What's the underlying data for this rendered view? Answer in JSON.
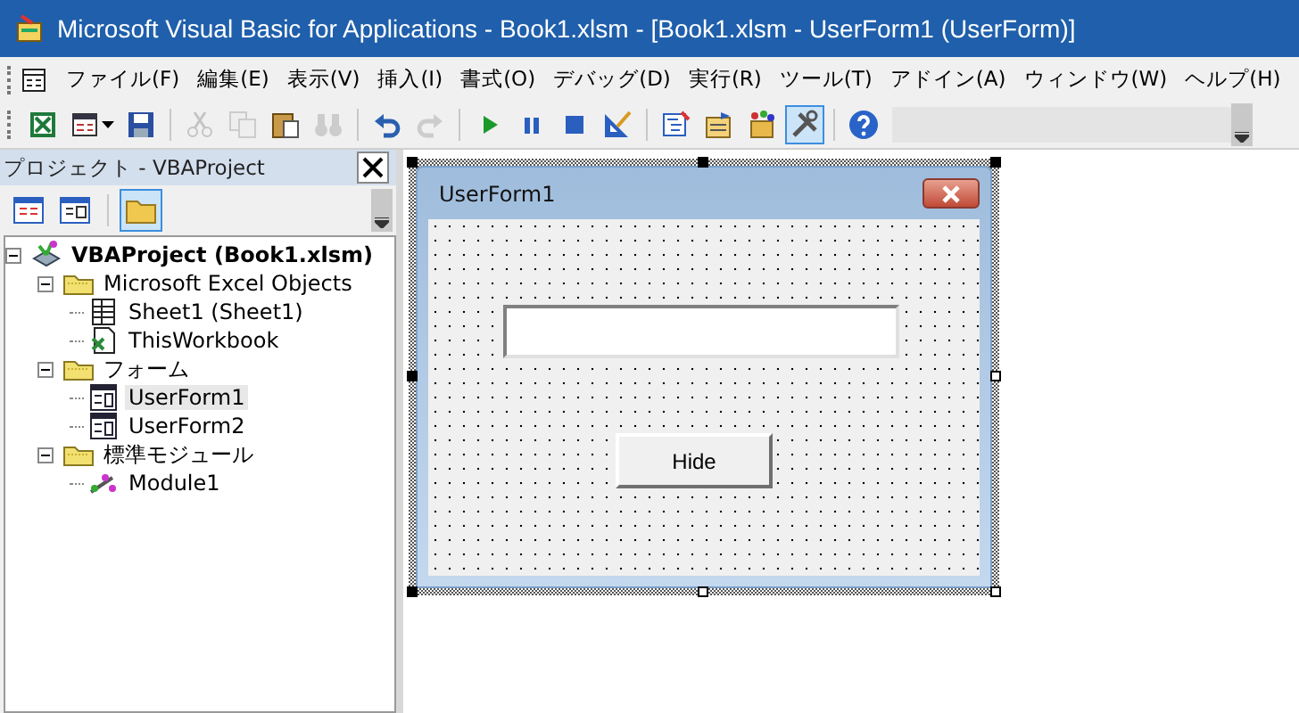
{
  "window": {
    "title": "Microsoft Visual Basic for Applications - Book1.xlsm - [Book1.xlsm - UserForm1 (UserForm)]"
  },
  "menu": [
    "ファイル(F)",
    "編集(E)",
    "表示(V)",
    "挿入(I)",
    "書式(O)",
    "デバッグ(D)",
    "実行(R)",
    "ツール(T)",
    "アドイン(A)",
    "ウィンドウ(W)",
    "ヘルプ(H)"
  ],
  "toolbar": [
    {
      "kind": "excel",
      "disabled": false,
      "selected": false
    },
    {
      "kind": "insert-form",
      "disabled": false,
      "selected": false
    },
    {
      "kind": "save",
      "disabled": false,
      "selected": false
    },
    {
      "kind": "separator"
    },
    {
      "kind": "cut",
      "disabled": true,
      "selected": false
    },
    {
      "kind": "copy",
      "disabled": true,
      "selected": false
    },
    {
      "kind": "paste",
      "disabled": false,
      "selected": false
    },
    {
      "kind": "find",
      "disabled": true,
      "selected": false
    },
    {
      "kind": "separator"
    },
    {
      "kind": "undo",
      "disabled": false,
      "selected": false
    },
    {
      "kind": "redo",
      "disabled": true,
      "selected": false
    },
    {
      "kind": "separator"
    },
    {
      "kind": "run",
      "disabled": false,
      "selected": false
    },
    {
      "kind": "pause",
      "disabled": false,
      "selected": false
    },
    {
      "kind": "stop",
      "disabled": false,
      "selected": false
    },
    {
      "kind": "design",
      "disabled": false,
      "selected": false
    },
    {
      "kind": "separator"
    },
    {
      "kind": "explorer",
      "disabled": false,
      "selected": false
    },
    {
      "kind": "properties",
      "disabled": false,
      "selected": false
    },
    {
      "kind": "browser",
      "disabled": false,
      "selected": false
    },
    {
      "kind": "toolbox",
      "disabled": false,
      "selected": true
    },
    {
      "kind": "separator"
    },
    {
      "kind": "help",
      "disabled": false,
      "selected": false
    }
  ],
  "project_panel": {
    "title": "プロジェクト - VBAProject",
    "buttons": [
      {
        "kind": "code",
        "selected": false
      },
      {
        "kind": "object",
        "selected": false
      },
      {
        "kind": "folders",
        "selected": true
      }
    ],
    "tree": [
      {
        "label": "VBAProject (Book1.xlsm)",
        "kind": "project",
        "expanded": true,
        "selected": false,
        "children": [
          {
            "label": "Microsoft Excel Objects",
            "kind": "folder",
            "expanded": true,
            "selected": false,
            "children": [
              {
                "label": "Sheet1 (Sheet1)",
                "kind": "sheet",
                "selected": false
              },
              {
                "label": "ThisWorkbook",
                "kind": "workbook",
                "selected": false
              }
            ]
          },
          {
            "label": "フォーム",
            "kind": "folder",
            "expanded": true,
            "selected": false,
            "children": [
              {
                "label": "UserForm1",
                "kind": "form",
                "selected": true
              },
              {
                "label": "UserForm2",
                "kind": "form",
                "selected": false
              }
            ]
          },
          {
            "label": "標準モジュール",
            "kind": "folder",
            "expanded": true,
            "selected": false,
            "children": [
              {
                "label": "Module1",
                "kind": "module",
                "selected": false
              }
            ]
          }
        ]
      }
    ]
  },
  "form": {
    "caption": "UserForm1",
    "controls": [
      {
        "kind": "textbox"
      },
      {
        "kind": "button",
        "label": "Hide"
      }
    ]
  }
}
